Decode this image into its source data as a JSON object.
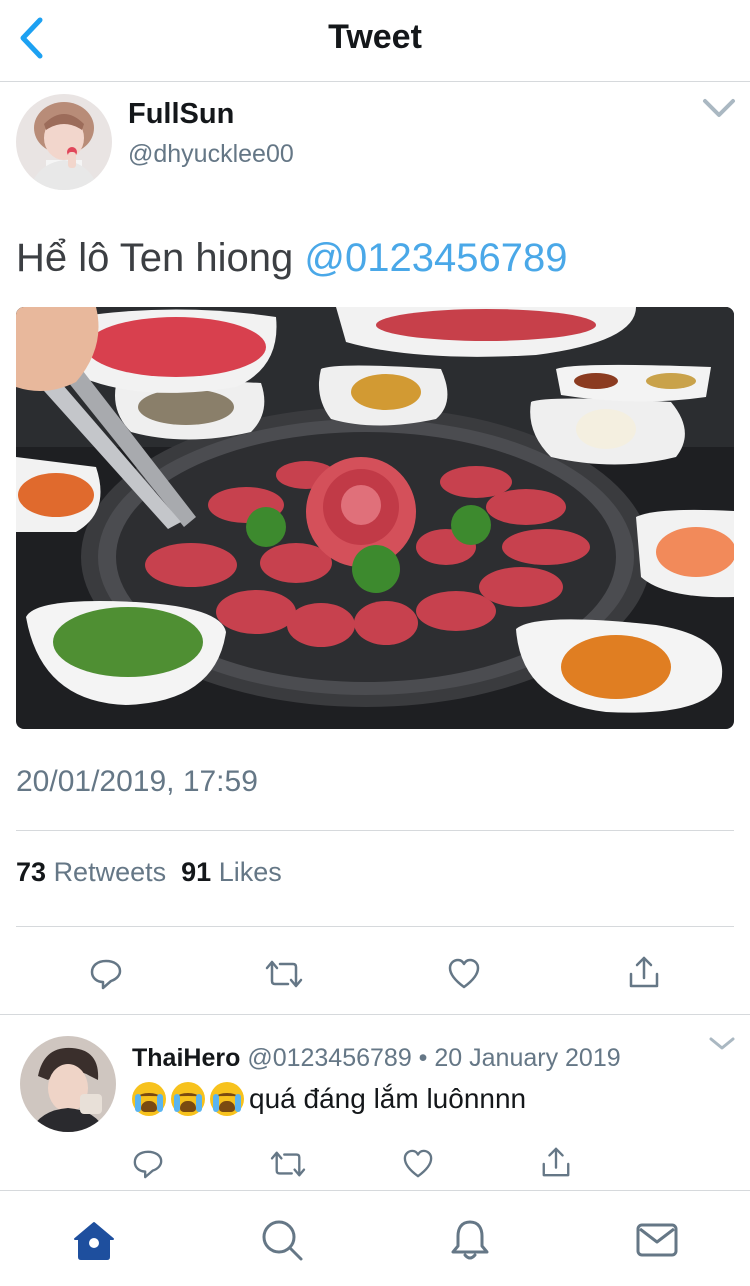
{
  "header": {
    "title": "Tweet",
    "back_icon": "chevron-left-icon"
  },
  "tweet": {
    "author_name": "FullSun",
    "author_handle": "@dhyucklee00",
    "text_plain": "Hể lô Ten hiong",
    "text_mention": "@0123456789",
    "timestamp": "20/01/2019, 17:59",
    "retweets_count": "73",
    "retweets_label": "Retweets",
    "likes_count": "91",
    "likes_label": "Likes",
    "photo_icon": "food-photo-icon"
  },
  "reply": {
    "author_name": "ThaiHero",
    "author_handle": "@0123456789",
    "separator": " • ",
    "date": "20 January 2019",
    "text": "quá đáng lắm luônnnn",
    "emoji": "loudly-crying-face-icon"
  },
  "tabbar": {
    "items": [
      "home-icon",
      "search-icon",
      "notifications-icon",
      "messages-icon"
    ],
    "active": "home-icon"
  },
  "colors": {
    "accent": "#1da1f2",
    "mention": "#4aa8e8",
    "text": "#14171a",
    "secondary": "#657786",
    "divider": "#d6d9dc",
    "active_tab": "#1e4f9e"
  }
}
